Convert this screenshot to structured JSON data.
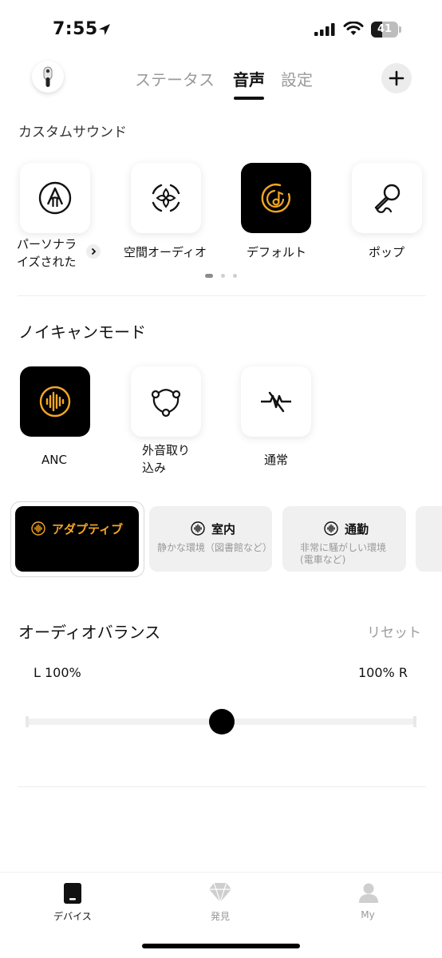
{
  "status_bar": {
    "time": "7:55",
    "battery_level": "41",
    "battery_fraction": 0.41
  },
  "top_nav": {
    "tabs": [
      {
        "label": "ステータス",
        "active": false
      },
      {
        "label": "音声",
        "active": true
      },
      {
        "label": "設定",
        "active": false
      }
    ]
  },
  "custom_sound": {
    "title": "カスタムサウンド",
    "items": [
      {
        "label": "パーソナライズされた",
        "label_line1": "パーソナラ",
        "label_line2": "イズされた",
        "icon": "personalize-icon",
        "selected": false
      },
      {
        "label": "空間オーディオ",
        "icon": "spatial-audio-icon",
        "selected": false
      },
      {
        "label": "デフォルト",
        "icon": "default-music-icon",
        "selected": true
      },
      {
        "label": "ポップ",
        "icon": "microphone-icon",
        "selected": false
      }
    ],
    "page_dots": 3,
    "active_page": 0
  },
  "noise_cancel": {
    "title": "ノイキャンモード",
    "modes": [
      {
        "label": "ANC",
        "icon": "anc-waveform-icon",
        "selected": true
      },
      {
        "label": "外音取り込み",
        "label_line1": "外音取り",
        "label_line2": "込み",
        "icon": "transparency-icon",
        "selected": false
      },
      {
        "label": "通常",
        "icon": "noise-off-icon",
        "selected": false
      }
    ],
    "anc_options": [
      {
        "title": "アダプティブ",
        "subtitle": "",
        "selected": true
      },
      {
        "title": "室内",
        "subtitle": "静かな環境（図書館など）",
        "selected": false
      },
      {
        "title": "通勤",
        "subtitle_line1": "非常に騒がしい環境",
        "subtitle_line2": "(電車など)",
        "selected": false
      }
    ]
  },
  "audio_balance": {
    "title": "オーディオバランス",
    "reset_label": "リセット",
    "left_label": "L 100%",
    "right_label": "100% R",
    "value": 0.5
  },
  "bottom_nav": {
    "items": [
      {
        "label": "デバイス",
        "icon": "device-icon",
        "active": true
      },
      {
        "label": "発見",
        "icon": "discover-diamond-icon",
        "active": false
      },
      {
        "label": "My",
        "icon": "profile-icon",
        "active": false
      }
    ]
  },
  "colors": {
    "accent": "#f5a623",
    "selected_bg": "#000000",
    "inactive_text": "#9b9b9b"
  }
}
